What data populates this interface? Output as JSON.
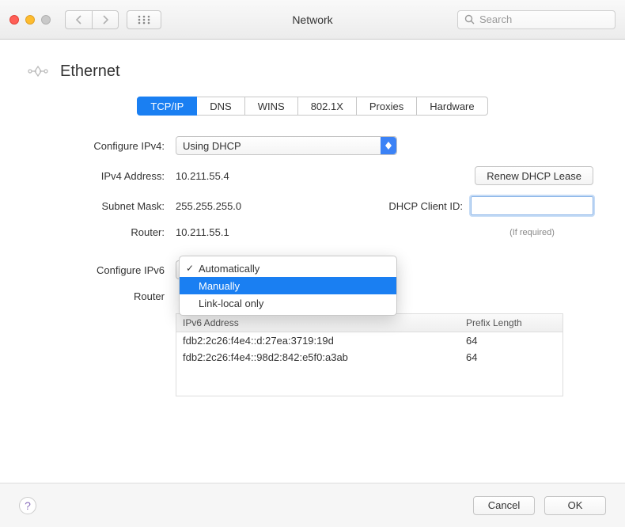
{
  "window": {
    "title": "Network",
    "search_placeholder": "Search"
  },
  "header": {
    "interface": "Ethernet"
  },
  "tabs": [
    "TCP/IP",
    "DNS",
    "WINS",
    "802.1X",
    "Proxies",
    "Hardware"
  ],
  "active_tab": 0,
  "ipv4": {
    "configure_label": "Configure IPv4:",
    "configure_value": "Using DHCP",
    "address_label": "IPv4 Address:",
    "address_value": "10.211.55.4",
    "subnet_label": "Subnet Mask:",
    "subnet_value": "255.255.255.0",
    "router_label": "Router:",
    "router_value": "10.211.55.1",
    "renew_label": "Renew DHCP Lease",
    "dhcp_client_label": "DHCP Client ID:",
    "dhcp_client_value": "",
    "dhcp_client_hint": "(If required)"
  },
  "ipv6": {
    "configure_label": "Configure IPv6",
    "router_label": "Router",
    "menu": {
      "options": [
        "Automatically",
        "Manually",
        "Link-local only"
      ],
      "checked": 0,
      "highlighted": 1
    },
    "table": {
      "cols": [
        "IPv6 Address",
        "Prefix Length"
      ],
      "rows": [
        {
          "addr": "fdb2:2c26:f4e4::d:27ea:3719:19d",
          "pfx": "64"
        },
        {
          "addr": "fdb2:2c26:f4e4::98d2:842:e5f0:a3ab",
          "pfx": "64"
        }
      ]
    }
  },
  "footer": {
    "cancel": "Cancel",
    "ok": "OK"
  }
}
